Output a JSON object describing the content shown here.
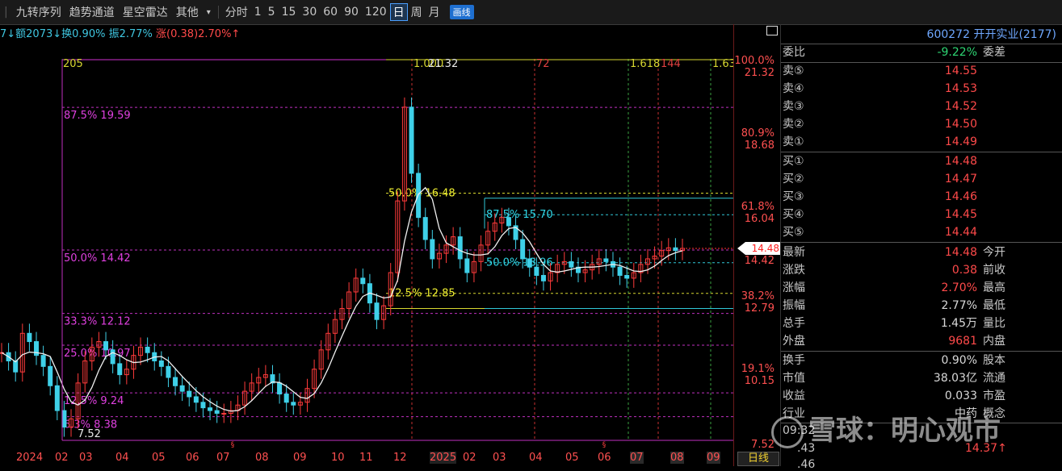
{
  "toolbar": {
    "items": [
      "九转序列",
      "趋势通道",
      "星空雷达",
      "其他"
    ],
    "periods": [
      "分时",
      "1",
      "5",
      "15",
      "30",
      "60",
      "90",
      "120",
      "日",
      "周",
      "月"
    ],
    "active_period": "日",
    "draw_label": "画线"
  },
  "info_bar": {
    "part1": "7↓额2073↓",
    "part2": "换0.90%",
    "part3": "振2.77%",
    "part4": "涨(0.38)2.70%↑"
  },
  "chart_data": {
    "type": "candlestick",
    "y_range": [
      7.52,
      21.32
    ],
    "x_labels": [
      "2024",
      "02",
      "03",
      "04",
      "05",
      "06",
      "07",
      "08",
      "09",
      "10",
      "11",
      "12",
      "2025",
      "02",
      "03",
      "04",
      "05",
      "06",
      "07",
      "08",
      "09"
    ],
    "fib_left": [
      {
        "label": "87.5% 19.59",
        "value": 19.59
      },
      {
        "label": "50.0% 14.42",
        "value": 14.42
      },
      {
        "label": "33.3% 12.12",
        "value": 12.12
      },
      {
        "label": "25.0% 10.97",
        "value": 10.97
      },
      {
        "label": "12.5% 9.24",
        "value": 9.24
      },
      {
        "label": "6.3% 8.38",
        "value": 8.38
      }
    ],
    "fib_mid": [
      {
        "label": "50.0% 16.48",
        "value": 16.48
      },
      {
        "label": "12.5% 12.85",
        "value": 12.85
      }
    ],
    "fib_cyan": [
      {
        "label": "87.5% 15.70",
        "value": 15.7
      },
      {
        "label": "50.0% 13.96",
        "value": 13.96
      }
    ],
    "right_axis": [
      {
        "pct": "100.0%",
        "price": "21.32",
        "value": 21.32
      },
      {
        "pct": "80.9%",
        "price": "18.68",
        "value": 18.68
      },
      {
        "pct": "61.8%",
        "price": "16.04",
        "value": 16.04
      },
      {
        "pct": "38.2%",
        "price": "12.79",
        "value": 12.79
      },
      {
        "pct": "19.1%",
        "price": "10.15",
        "value": 10.15
      }
    ],
    "top_labels": [
      "205",
      "1.000",
      "21.32",
      "72",
      "1.618",
      "144",
      "1.63"
    ],
    "low_label": "7.52",
    "axis_bottom": "7.52",
    "current_price": "14.48",
    "current_right_label": "14.42",
    "period_label": "日线",
    "close_series": [
      10.7,
      10.4,
      10.0,
      11.4,
      11.1,
      10.6,
      10.2,
      9.5,
      8.6,
      8.0,
      8.3,
      9.6,
      10.4,
      10.9,
      11.1,
      10.8,
      10.3,
      9.9,
      10.1,
      10.6,
      10.9,
      10.7,
      10.4,
      10.2,
      9.8,
      9.5,
      9.3,
      9.1,
      8.9,
      8.7,
      8.6,
      8.5,
      8.5,
      8.6,
      8.8,
      9.3,
      9.6,
      9.8,
      9.9,
      9.6,
      9.2,
      8.9,
      8.8,
      8.9,
      9.4,
      10.1,
      10.8,
      11.4,
      11.9,
      12.3,
      12.9,
      13.4,
      13.2,
      12.5,
      11.9,
      12.4,
      13.6,
      16.2,
      19.6,
      17.2,
      15.6,
      14.8,
      14.1,
      14.3,
      14.6,
      14.9,
      14.1,
      13.6,
      14.0,
      14.6,
      15.1,
      15.4,
      15.6,
      15.3,
      14.8,
      14.1,
      13.8,
      13.5,
      13.3,
      13.6,
      13.9,
      14.0,
      13.8,
      13.6,
      13.7,
      13.9,
      14.1,
      14.0,
      13.8,
      13.5,
      13.4,
      13.6,
      13.9,
      14.1,
      14.2,
      14.4,
      14.5,
      14.4,
      14.48
    ]
  },
  "panel": {
    "header": "600272 开开实业(2177)",
    "weibi": {
      "label": "委比",
      "value": "-9.22%",
      "right": "委差"
    },
    "sells": [
      {
        "label": "卖⑤",
        "value": "14.55"
      },
      {
        "label": "卖④",
        "value": "14.53"
      },
      {
        "label": "卖③",
        "value": "14.52"
      },
      {
        "label": "卖②",
        "value": "14.50"
      },
      {
        "label": "卖①",
        "value": "14.49"
      }
    ],
    "buys": [
      {
        "label": "买①",
        "value": "14.48"
      },
      {
        "label": "买②",
        "value": "14.47"
      },
      {
        "label": "买③",
        "value": "14.46"
      },
      {
        "label": "买④",
        "value": "14.45"
      },
      {
        "label": "买⑤",
        "value": "14.44"
      }
    ],
    "stats": [
      {
        "label": "最新",
        "value": "14.48",
        "right": "今开",
        "color": "red"
      },
      {
        "label": "涨跌",
        "value": "0.38",
        "right": "前收",
        "color": "red"
      },
      {
        "label": "涨幅",
        "value": "2.70%",
        "right": "最高",
        "color": "red"
      },
      {
        "label": "振幅",
        "value": "2.77%",
        "right": "最低",
        "color": "wh"
      },
      {
        "label": "总手",
        "value": "1.45万",
        "right": "量比",
        "color": "wh"
      },
      {
        "label": "外盘",
        "value": "9681",
        "right": "内盘",
        "color": "red"
      }
    ],
    "stats2": [
      {
        "label": "换手",
        "value": "0.90%",
        "right": "股本",
        "color": "wh"
      },
      {
        "label": "市值",
        "value": "38.03亿",
        "right": "流通",
        "color": "wh"
      },
      {
        "label": "收益",
        "value": "0.033",
        "right": "市盈",
        "color": "wh"
      },
      {
        "label": "行业",
        "value": "中药",
        "right": "概念",
        "color": "wh"
      }
    ],
    "tick1_time": "09:32",
    "tick2_value": "14.37↑",
    "tick2_left": ".43",
    "tick3_left": ".46"
  },
  "watermark": {
    "text": "雪球：明心观市"
  }
}
